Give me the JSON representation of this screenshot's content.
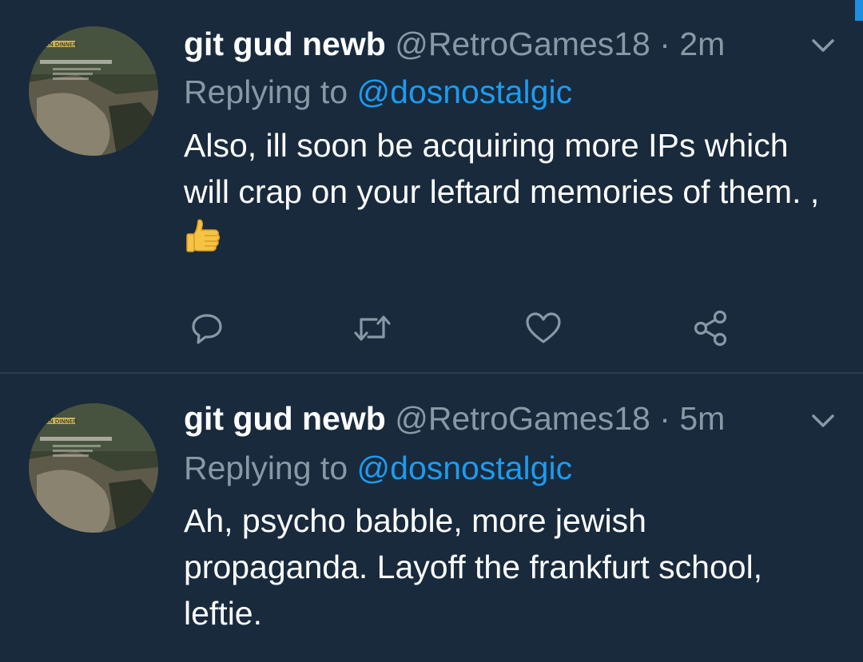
{
  "colors": {
    "background": "#182a3c",
    "secondary_text": "#8899a6",
    "link": "#1d9bf0",
    "divider": "#2b3e50"
  },
  "tweets": [
    {
      "display_name": "git gud newb",
      "handle": "@RetroGames18",
      "separator": "·",
      "time": "2m",
      "replying_prefix": "Replying to",
      "replying_to": "@dosnostalgic",
      "text": "Also, ill soon be acquiring more IPs which will crap on your leftard memories of them. ,",
      "emoji": "thumbs-up-icon",
      "avatar_caption": "..KEN DINNER",
      "actions": [
        "reply-icon",
        "retweet-icon",
        "like-icon",
        "share-icon"
      ]
    },
    {
      "display_name": "git gud newb",
      "handle": "@RetroGames18",
      "separator": "·",
      "time": "5m",
      "replying_prefix": "Replying to",
      "replying_to": "@dosnostalgic",
      "text": "Ah, psycho babble, more jewish propaganda. Layoff the frankfurt school, leftie.",
      "avatar_caption": "..KEN DINNER"
    }
  ]
}
